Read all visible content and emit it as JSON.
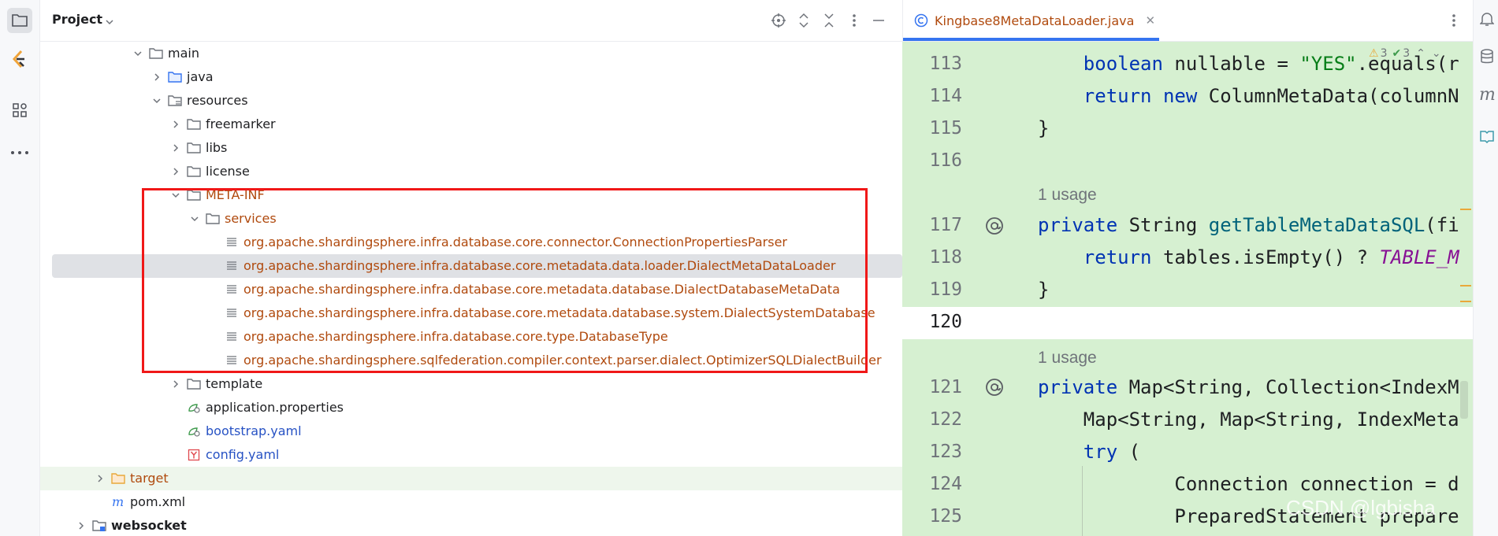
{
  "sidebar": {
    "items": [
      {
        "name": "project-icon"
      },
      {
        "name": "plugin-logo-icon"
      },
      {
        "name": "structure-icon"
      },
      {
        "name": "more-icon"
      }
    ]
  },
  "project": {
    "title": "Project",
    "tree": [
      {
        "label": "main",
        "kind": "folder",
        "expanded": true,
        "color": "dark"
      },
      {
        "label": "java",
        "kind": "folder-src",
        "expanded": false,
        "color": "dark"
      },
      {
        "label": "resources",
        "kind": "folder-res",
        "expanded": true,
        "color": "dark"
      },
      {
        "label": "freemarker",
        "kind": "folder",
        "expanded": false,
        "color": "dark"
      },
      {
        "label": "libs",
        "kind": "folder",
        "expanded": false,
        "color": "dark"
      },
      {
        "label": "license",
        "kind": "folder",
        "expanded": false,
        "color": "dark"
      },
      {
        "label": "META-INF",
        "kind": "folder",
        "expanded": true,
        "color": "brown"
      },
      {
        "label": "services",
        "kind": "folder",
        "expanded": true,
        "color": "brown"
      },
      {
        "label": "org.apache.shardingsphere.infra.database.core.connector.ConnectionPropertiesParser",
        "kind": "file-text",
        "color": "brown"
      },
      {
        "label": "org.apache.shardingsphere.infra.database.core.metadata.data.loader.DialectMetaDataLoader",
        "kind": "file-text",
        "color": "brown",
        "selected": true
      },
      {
        "label": "org.apache.shardingsphere.infra.database.core.metadata.database.DialectDatabaseMetaData",
        "kind": "file-text",
        "color": "brown"
      },
      {
        "label": "org.apache.shardingsphere.infra.database.core.metadata.database.system.DialectSystemDatabase",
        "kind": "file-text",
        "color": "brown"
      },
      {
        "label": "org.apache.shardingsphere.infra.database.core.type.DatabaseType",
        "kind": "file-text",
        "color": "brown"
      },
      {
        "label": "org.apache.shardingsphere.sqlfederation.compiler.context.parser.dialect.OptimizerSQLDialectBuilder",
        "kind": "file-text",
        "color": "brown"
      },
      {
        "label": "template",
        "kind": "folder",
        "expanded": false,
        "color": "dark"
      },
      {
        "label": "application.properties",
        "kind": "file-props",
        "color": "dark"
      },
      {
        "label": "bootstrap.yaml",
        "kind": "file-props",
        "color": "blue"
      },
      {
        "label": "config.yaml",
        "kind": "file-yaml",
        "color": "blue"
      },
      {
        "label": "target",
        "kind": "folder-orange",
        "expanded": false,
        "color": "brown",
        "highlight": true
      },
      {
        "label": "pom.xml",
        "kind": "file-maven",
        "color": "dark"
      },
      {
        "label": "websocket",
        "kind": "folder-module",
        "expanded": false,
        "color": "bold"
      }
    ]
  },
  "editor": {
    "tab_label": "Kingbase8MetaDataLoader.java",
    "warnings_count": "3",
    "checks_count": "3",
    "usage_label": "1 usage",
    "line_numbers": [
      "113",
      "114",
      "115",
      "116",
      "117",
      "118",
      "119",
      "120",
      "121",
      "122",
      "123",
      "124",
      "125"
    ],
    "watermark": "CSDN @lgbisha"
  }
}
